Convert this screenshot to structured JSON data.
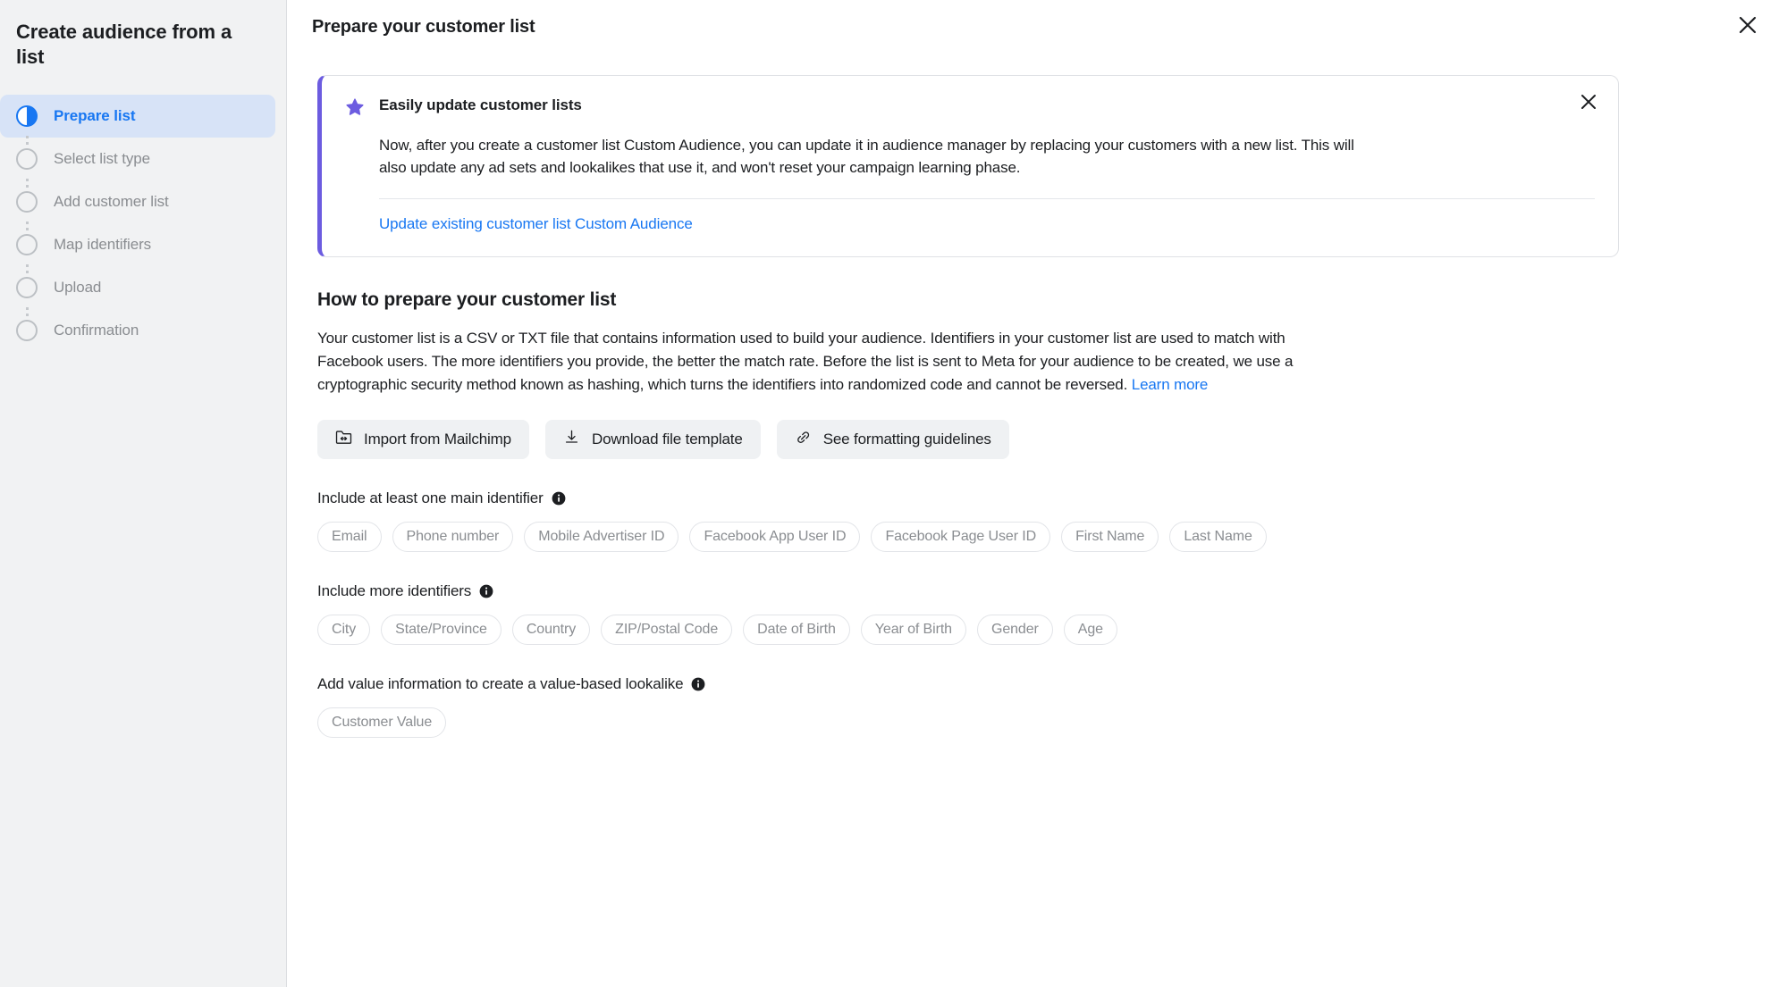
{
  "sidebar": {
    "title": "Create audience from a list",
    "steps": [
      {
        "label": "Prepare list",
        "state": "active",
        "icon": "half-filled-circle-icon"
      },
      {
        "label": "Select list type",
        "state": "pending",
        "icon": "empty-circle-icon"
      },
      {
        "label": "Add customer list",
        "state": "pending",
        "icon": "empty-circle-icon"
      },
      {
        "label": "Map identifiers",
        "state": "pending",
        "icon": "empty-circle-icon"
      },
      {
        "label": "Upload",
        "state": "pending",
        "icon": "empty-circle-icon"
      },
      {
        "label": "Confirmation",
        "state": "pending",
        "icon": "empty-circle-icon"
      }
    ]
  },
  "header": {
    "title": "Prepare your customer list",
    "close_icon": "close-icon"
  },
  "banner": {
    "icon": "star-icon",
    "title": "Easily update customer lists",
    "body": "Now, after you create a customer list Custom Audience, you can update it in audience manager by replacing your customers with a new list. This will also update any ad sets and lookalikes that use it, and won't reset your campaign learning phase.",
    "link": "Update existing customer list Custom Audience",
    "close_icon": "close-icon",
    "accent_color": "#6c5ce0"
  },
  "how_to": {
    "heading": "How to prepare your customer list",
    "paragraph": "Your customer list is a CSV or TXT file that contains information used to build your audience. Identifiers in your customer list are used to match with Facebook users. The more identifiers you provide, the better the match rate. Before the list is sent to Meta for your audience to be created, we use a cryptographic security method known as hashing, which turns the identifiers into randomized code and cannot be reversed. ",
    "learn_more": "Learn more"
  },
  "actions": [
    {
      "label": "Import from Mailchimp",
      "icon": "folder-import-icon"
    },
    {
      "label": "Download file template",
      "icon": "download-icon"
    },
    {
      "label": "See formatting guidelines",
      "icon": "link-chain-icon"
    }
  ],
  "main_identifiers": {
    "label": "Include at least one main identifier",
    "info_icon": "info-icon",
    "chips": [
      "Email",
      "Phone number",
      "Mobile Advertiser ID",
      "Facebook App User ID",
      "Facebook Page User ID",
      "First Name",
      "Last Name"
    ]
  },
  "more_identifiers": {
    "label": "Include more identifiers",
    "info_icon": "info-icon",
    "chips": [
      "City",
      "State/Province",
      "Country",
      "ZIP/Postal Code",
      "Date of Birth",
      "Year of Birth",
      "Gender",
      "Age"
    ]
  },
  "value_section": {
    "label": "Add value information to create a value-based lookalike",
    "info_icon": "info-icon",
    "chips": [
      "Customer Value"
    ]
  },
  "colors": {
    "accent_blue": "#1877f2",
    "active_step_bg": "#d7e3f7",
    "sidebar_bg": "#f1f2f3",
    "banner_accent": "#6c5ce0",
    "text_primary": "#1c1e21",
    "text_muted": "#8a8d91"
  }
}
